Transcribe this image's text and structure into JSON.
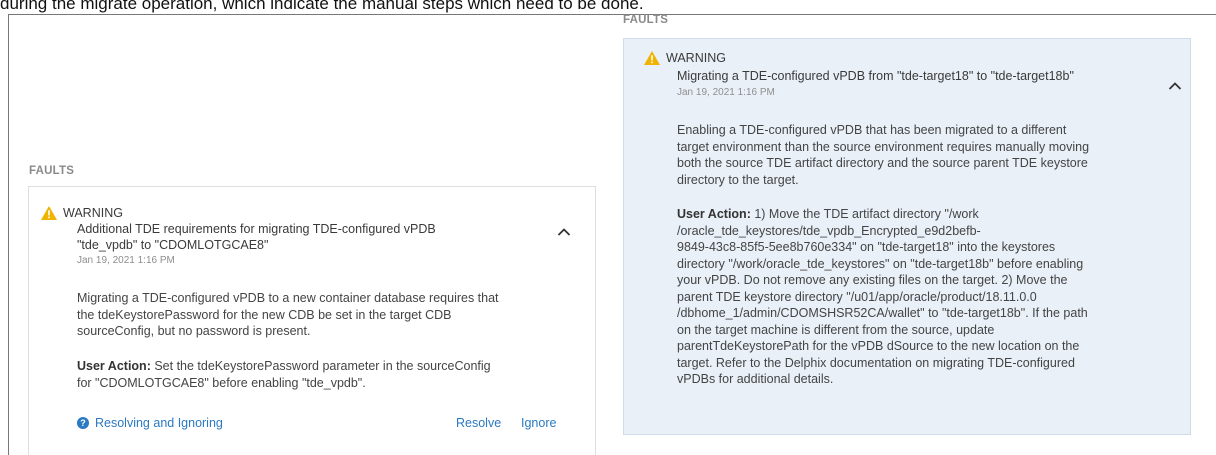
{
  "caption": "during the migrate operation, which indicate the manual steps which need to be done.",
  "left_panel": {
    "section_label": "FAULTS",
    "severity": "WARNING",
    "title_line1": "Additional TDE requirements for migrating TDE-configured vPDB",
    "title_line2": "\"tde_vpdb\" to \"CDOMLOTGCAE8\"",
    "date": "Jan 19, 2021 1:16 PM",
    "description": [
      "Migrating a TDE-configured vPDB to a new container database requires that",
      "the tdeKeystorePassword for the new CDB be set in the target CDB",
      "sourceConfig, but no password is present."
    ],
    "user_action_label": "User Action:",
    "user_action_line1": " Set the tdeKeystorePassword parameter in the sourceConfig",
    "user_action_line2": "for \"CDOMLOTGCAE8\" before enabling \"tde_vpdb\".",
    "help_link": "Resolving and Ignoring",
    "resolve_label": "Resolve",
    "ignore_label": "Ignore"
  },
  "right_panel": {
    "section_label": "FAULTS",
    "severity": "WARNING",
    "title": "Migrating a TDE-configured vPDB from \"tde-target18\" to \"tde-target18b\"",
    "date": "Jan 19, 2021 1:16 PM",
    "description": [
      "Enabling a TDE-configured vPDB that has been migrated to a different",
      "target environment than the source environment requires manually moving",
      "both the source TDE artifact directory and the source parent TDE keystore",
      "directory to the target."
    ],
    "user_action_label": "User Action:",
    "user_action_first": "  1) Move the TDE artifact directory \"/work",
    "user_action_lines": [
      "/oracle_tde_keystores/tde_vpdb_Encrypted_e9d2befb-",
      "9849-43c8-85f5-5ee8b760e334\" on \"tde-target18\" into the keystores",
      "directory \"/work/oracle_tde_keystores\" on \"tde-target18b\" before enabling",
      "your vPDB. Do not remove any existing files on the target. 2) Move the",
      "parent TDE keystore directory \"/u01/app/oracle/product/18.11.0.0",
      "/dbhome_1/admin/CDOMSHSR52CA/wallet\" to \"tde-target18b\". If the path",
      "on the target machine is different from the source, update",
      "parentTdeKeystorePath for the vPDB dSource to the new location on the",
      "target. Refer to the Delphix documentation on migrating TDE-configured",
      "vPDBs for additional details."
    ]
  },
  "colors": {
    "warning": "#f0b400",
    "link": "#2b79c2",
    "right_card_bg": "#e9f0f8"
  }
}
